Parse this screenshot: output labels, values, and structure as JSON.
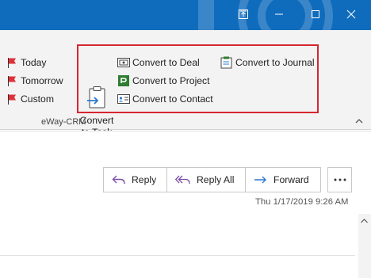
{
  "window": {
    "controls": [
      "restore-ribbon-icon",
      "minimize-icon",
      "maximize-icon",
      "close-icon"
    ],
    "title_bar_color": "#0f6cbd"
  },
  "ribbon": {
    "flags": [
      {
        "label": "Today",
        "icon": "red-flag-icon"
      },
      {
        "label": "Tomorrow",
        "icon": "red-flag-icon"
      },
      {
        "label": "Custom",
        "icon": "red-flag-icon"
      }
    ],
    "eway": {
      "convert_to_task": "Convert to Task",
      "convert_to_task_line1": "Convert",
      "convert_to_task_line2": "to Task",
      "convert_to_deal": "Convert to Deal",
      "convert_to_project": "Convert to Project",
      "convert_to_contact": "Convert to Contact",
      "convert_to_journal": "Convert to Journal"
    },
    "group_label": "eWay-CRM",
    "highlight_color": "#d7262e"
  },
  "message": {
    "actions": {
      "reply": "Reply",
      "reply_all": "Reply All",
      "forward": "Forward"
    },
    "more_icon": "more-icon",
    "timestamp": "Thu 1/17/2019 9:26 AM"
  },
  "colors": {
    "accent": "#0f6cbd",
    "reply_purple": "#7b4fa8",
    "forward_blue": "#2b79d0",
    "flag_red": "#e0303a"
  }
}
